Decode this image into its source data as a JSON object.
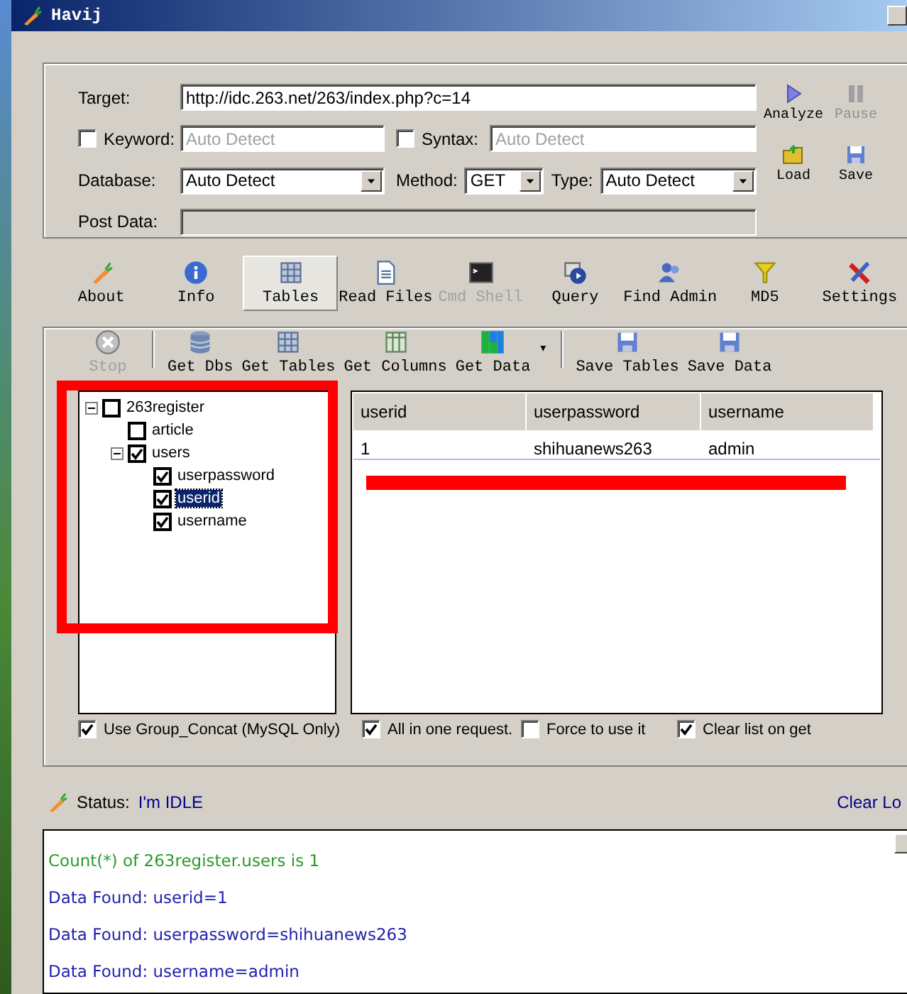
{
  "window": {
    "title": "Havij"
  },
  "target_form": {
    "target": {
      "label": "Target:",
      "value": "http://idc.263.net/263/index.php?c=14"
    },
    "keyword": {
      "label": "Keyword:",
      "checked": false,
      "placeholder": "Auto Detect"
    },
    "syntax": {
      "label": "Syntax:",
      "checked": false,
      "placeholder": "Auto Detect"
    },
    "database": {
      "label": "Database:",
      "value": "Auto Detect"
    },
    "method": {
      "label": "Method:",
      "value": "GET"
    },
    "type": {
      "label": "Type:",
      "value": "Auto Detect"
    },
    "post_data": {
      "label": "Post Data:",
      "disabled": true
    }
  },
  "actions": [
    {
      "kind": "analyze",
      "label": "Analyze",
      "disabled": false
    },
    {
      "kind": "pause",
      "label": "Pause",
      "disabled": true
    },
    {
      "kind": "load",
      "label": "Load",
      "disabled": false
    },
    {
      "kind": "save",
      "label": "Save",
      "disabled": false
    }
  ],
  "tabs": [
    {
      "kind": "about",
      "label": "About",
      "selected": false,
      "disabled": false
    },
    {
      "kind": "info",
      "label": "Info",
      "selected": false,
      "disabled": false
    },
    {
      "kind": "tables",
      "label": "Tables",
      "selected": true,
      "disabled": false
    },
    {
      "kind": "files",
      "label": "Read Files",
      "selected": false,
      "disabled": false
    },
    {
      "kind": "shell",
      "label": "Cmd Shell",
      "selected": false,
      "disabled": true
    },
    {
      "kind": "query",
      "label": "Query",
      "selected": false,
      "disabled": false
    },
    {
      "kind": "admin",
      "label": "Find Admin",
      "selected": false,
      "disabled": false
    },
    {
      "kind": "md5",
      "label": "MD5",
      "selected": false,
      "disabled": false
    },
    {
      "kind": "settings",
      "label": "Settings",
      "selected": false,
      "disabled": false
    }
  ],
  "toolbar": [
    {
      "kind": "stop",
      "label": "Stop",
      "disabled": true
    },
    {
      "kind": "dbs",
      "label": "Get Dbs",
      "disabled": false
    },
    {
      "kind": "tables",
      "label": "Get Tables",
      "disabled": false
    },
    {
      "kind": "columns",
      "label": "Get Columns",
      "disabled": false
    },
    {
      "kind": "data",
      "label": "Get Data",
      "disabled": false
    },
    {
      "kind": "menu",
      "label": "▾",
      "disabled": false
    },
    {
      "kind": "save",
      "label": "Save Tables",
      "disabled": false
    },
    {
      "kind": "save",
      "label": "Save Data",
      "disabled": false
    }
  ],
  "tree": [
    {
      "label": "263register",
      "checked": false,
      "expanded": true,
      "selected": false,
      "children": [
        {
          "label": "article",
          "checked": false,
          "selected": false
        },
        {
          "label": "users",
          "checked": true,
          "expanded": true,
          "selected": false,
          "children": [
            {
              "label": "userpassword",
              "checked": true,
              "selected": false
            },
            {
              "label": "userid",
              "checked": true,
              "selected": true
            },
            {
              "label": "username",
              "checked": true,
              "selected": false
            }
          ]
        }
      ]
    }
  ],
  "table": {
    "columns": [
      "userid",
      "userpassword",
      "username"
    ],
    "rows": [
      [
        "1",
        "shihuanews263",
        "admin"
      ]
    ]
  },
  "options": [
    {
      "label": "Use Group_Concat (MySQL Only)",
      "checked": true
    },
    {
      "label": "All in one request.",
      "checked": true
    },
    {
      "label": "Force to use it",
      "checked": false
    },
    {
      "label": "Clear list on get",
      "checked": true
    }
  ],
  "status": {
    "label": "Status:",
    "value": "I'm IDLE",
    "clear_log": "Clear Lo"
  },
  "log": [
    {
      "kind": "info",
      "text": "Count(*) of 263register.users is 1"
    },
    {
      "kind": "found",
      "text": "Data Found: userid=1"
    },
    {
      "kind": "found",
      "text": "Data Found: userpassword=shihuanews263"
    },
    {
      "kind": "found",
      "text": "Data Found: username=admin"
    }
  ],
  "tree_highlight": true,
  "row_redacted": true
}
